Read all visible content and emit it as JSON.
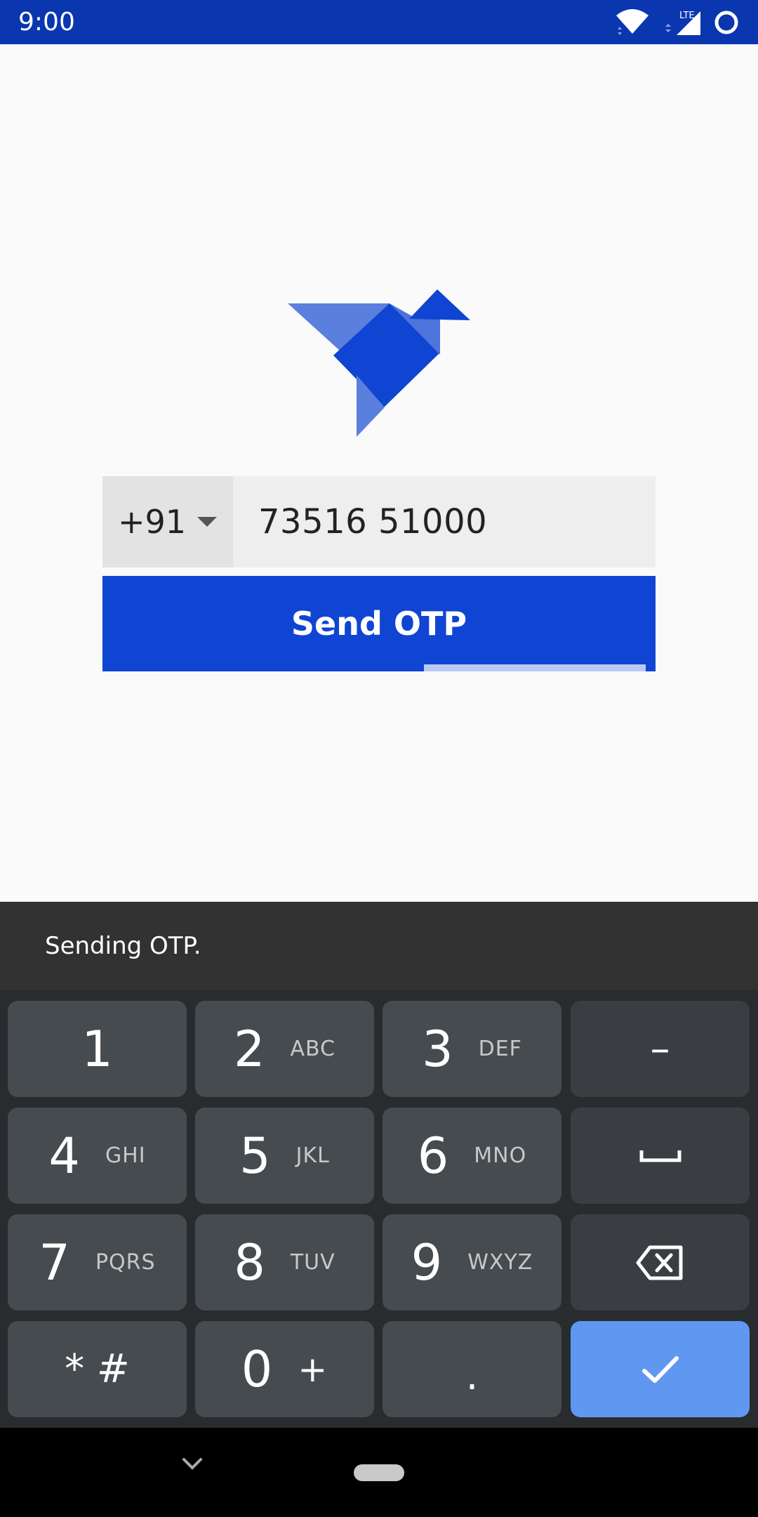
{
  "status_bar": {
    "time": "9:00",
    "network_label": "LTE",
    "icons": [
      "wifi-icon",
      "signal-icon",
      "circle-icon"
    ]
  },
  "login": {
    "country_code": "+91",
    "phone_number": "73516 51000",
    "send_button_label": "Send OTP",
    "progress": 0.5
  },
  "snackbar": {
    "message": "Sending OTP."
  },
  "keyboard": {
    "rows": [
      [
        {
          "num": "1",
          "letters": ""
        },
        {
          "num": "2",
          "letters": "ABC"
        },
        {
          "num": "3",
          "letters": "DEF"
        },
        {
          "sym": "–"
        }
      ],
      [
        {
          "num": "4",
          "letters": "GHI"
        },
        {
          "num": "5",
          "letters": "JKL"
        },
        {
          "num": "6",
          "letters": "MNO"
        },
        {
          "sym": "space"
        }
      ],
      [
        {
          "num": "7",
          "letters": "PQRS"
        },
        {
          "num": "8",
          "letters": "TUV"
        },
        {
          "num": "9",
          "letters": "WXYZ"
        },
        {
          "sym": "backspace"
        }
      ],
      [
        {
          "sym": "* #"
        },
        {
          "num": "0",
          "letters": "+"
        },
        {
          "sym": "."
        },
        {
          "sym": "done"
        }
      ]
    ]
  },
  "colors": {
    "primary": "#1044d2",
    "status_bar": "#0a36b0",
    "confirm_key": "#5f97f1"
  }
}
